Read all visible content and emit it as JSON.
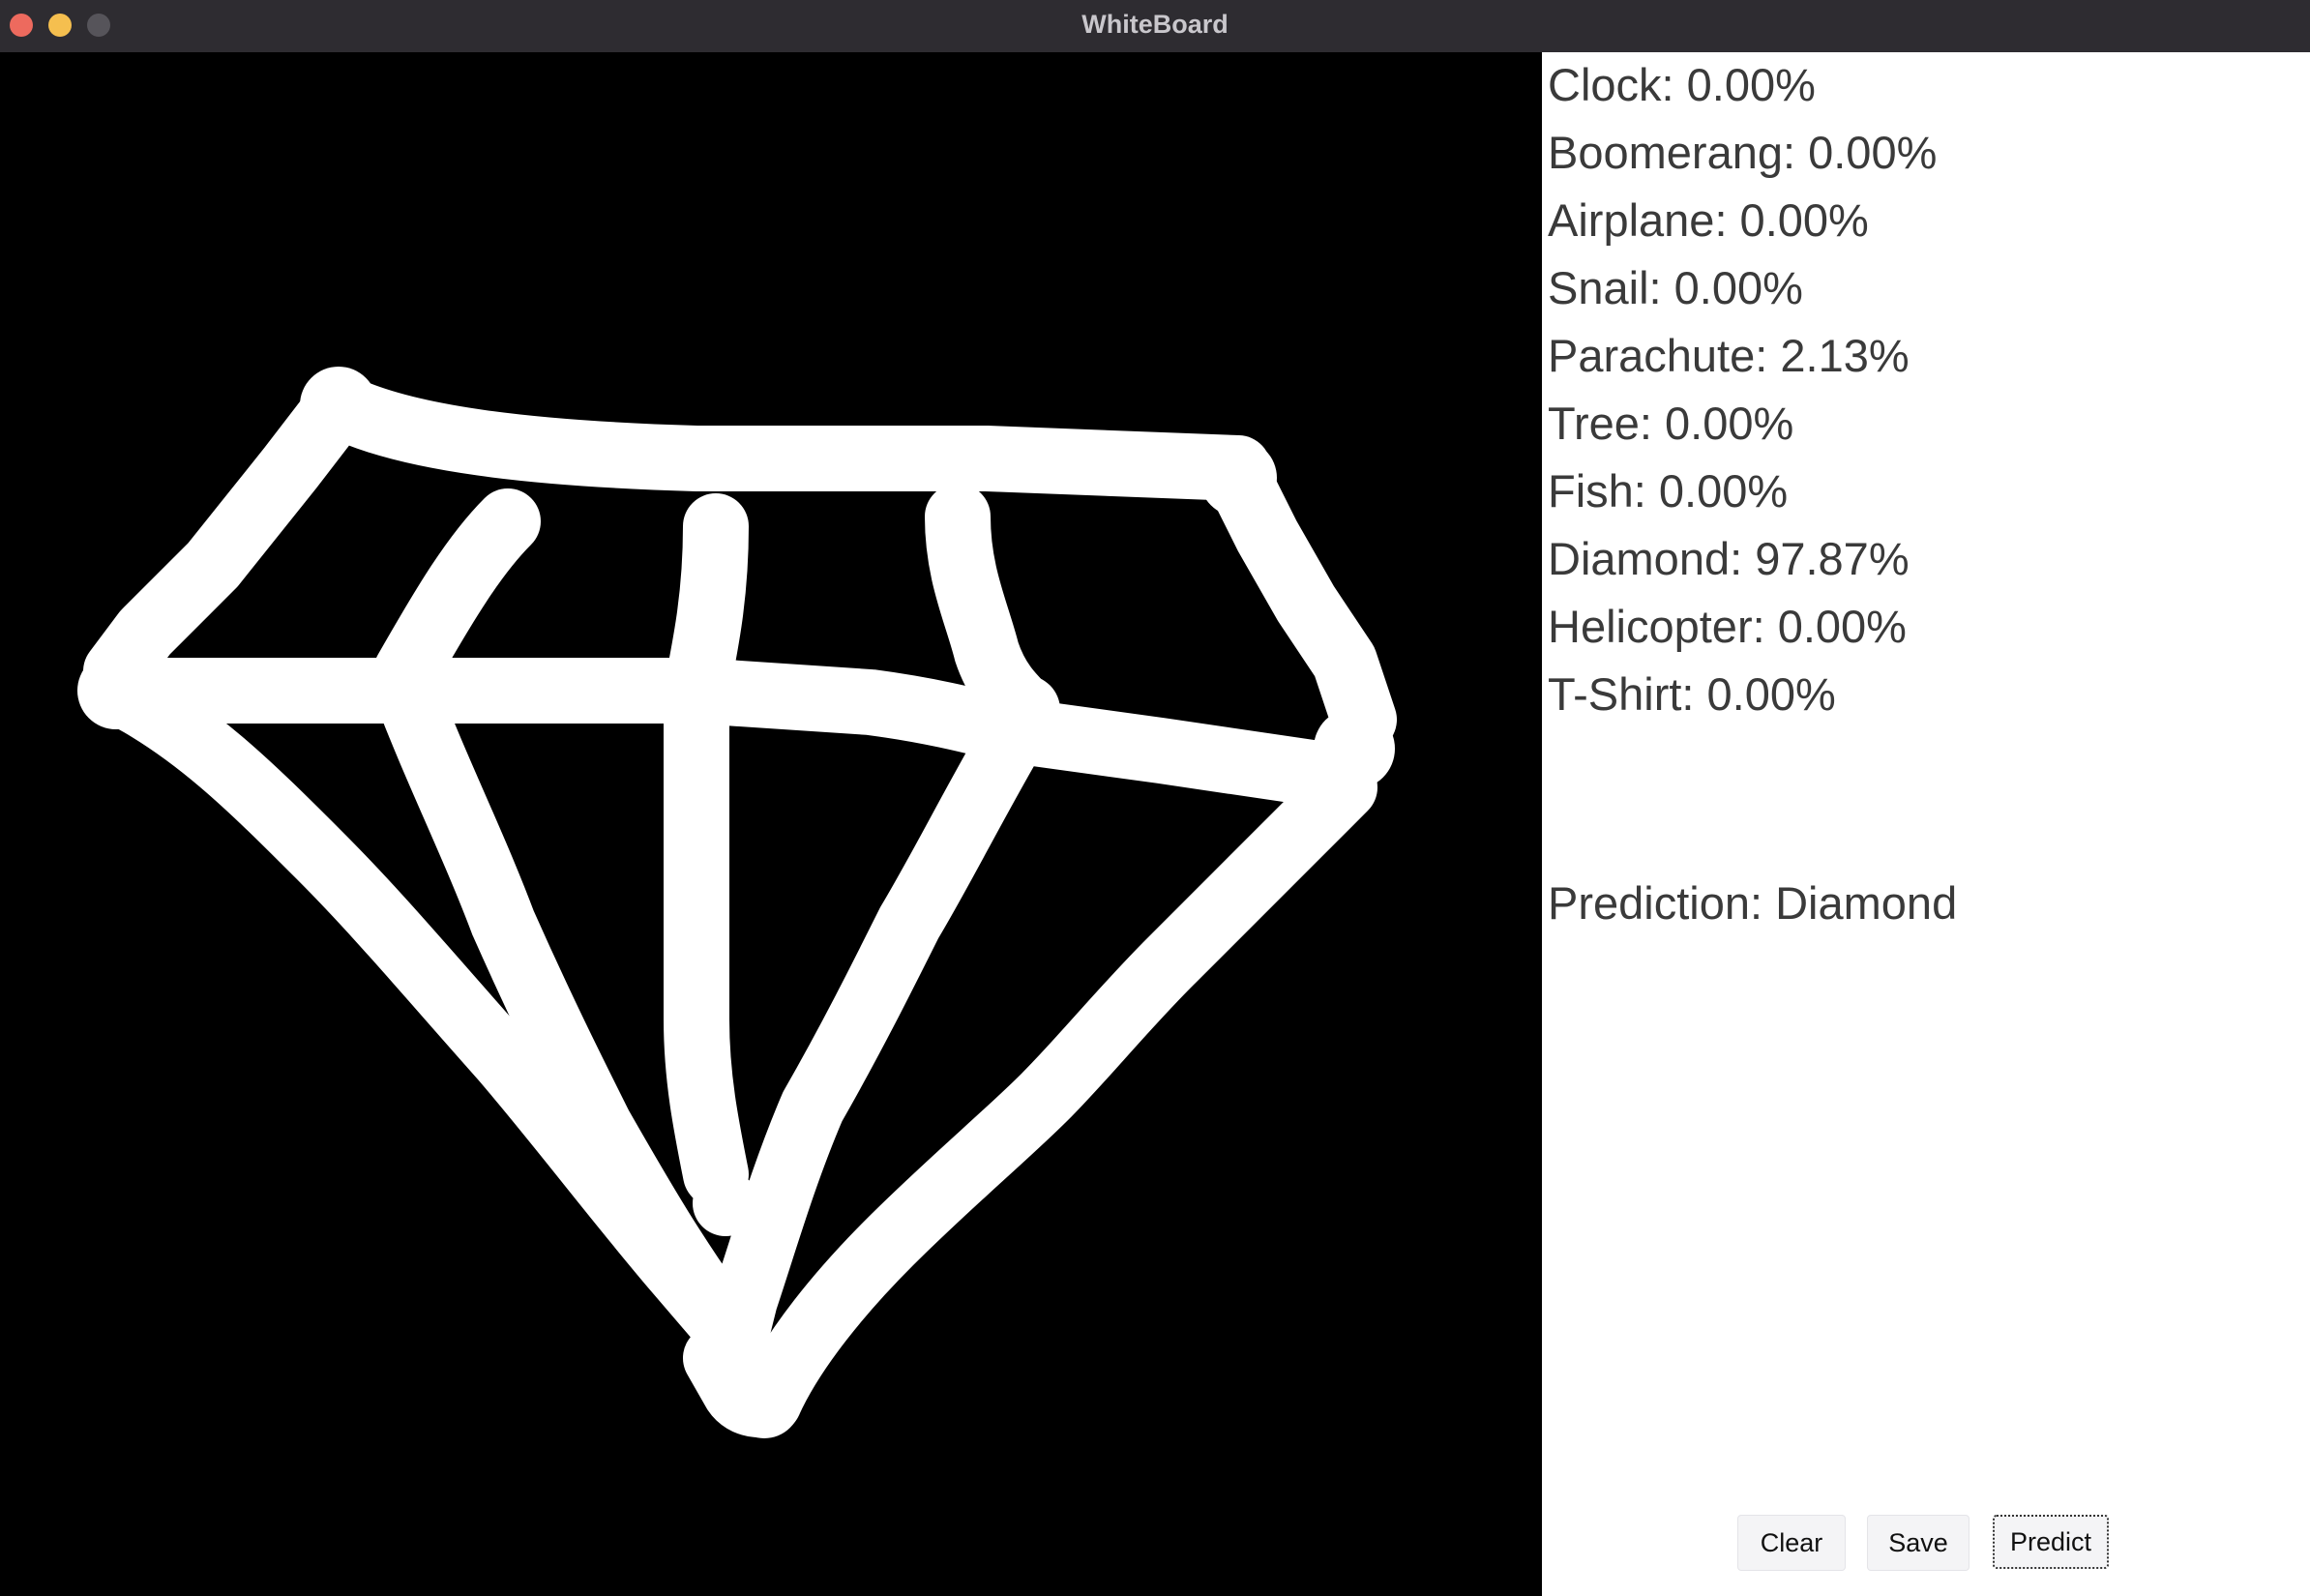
{
  "window": {
    "title": "WhiteBoard"
  },
  "scores": [
    {
      "label": "Clock: 0.00%"
    },
    {
      "label": "Boomerang: 0.00%"
    },
    {
      "label": "Airplane: 0.00%"
    },
    {
      "label": "Snail: 0.00%"
    },
    {
      "label": "Parachute: 2.13%"
    },
    {
      "label": "Tree: 0.00%"
    },
    {
      "label": "Fish: 0.00%"
    },
    {
      "label": "Diamond: 97.87%"
    },
    {
      "label": "Helicopter: 0.00%"
    },
    {
      "label": "T-Shirt: 0.00%"
    }
  ],
  "prediction": {
    "text": "Prediction: Diamond"
  },
  "buttons": {
    "clear": "Clear",
    "save": "Save",
    "predict": "Predict"
  },
  "colors": {
    "canvas_background": "#000000",
    "stroke": "#ffffff",
    "titlebar": "#2e2c31"
  },
  "icons": {
    "close": "close-dot-icon",
    "minimize": "minimize-dot-icon",
    "zoom": "zoom-dot-icon"
  }
}
